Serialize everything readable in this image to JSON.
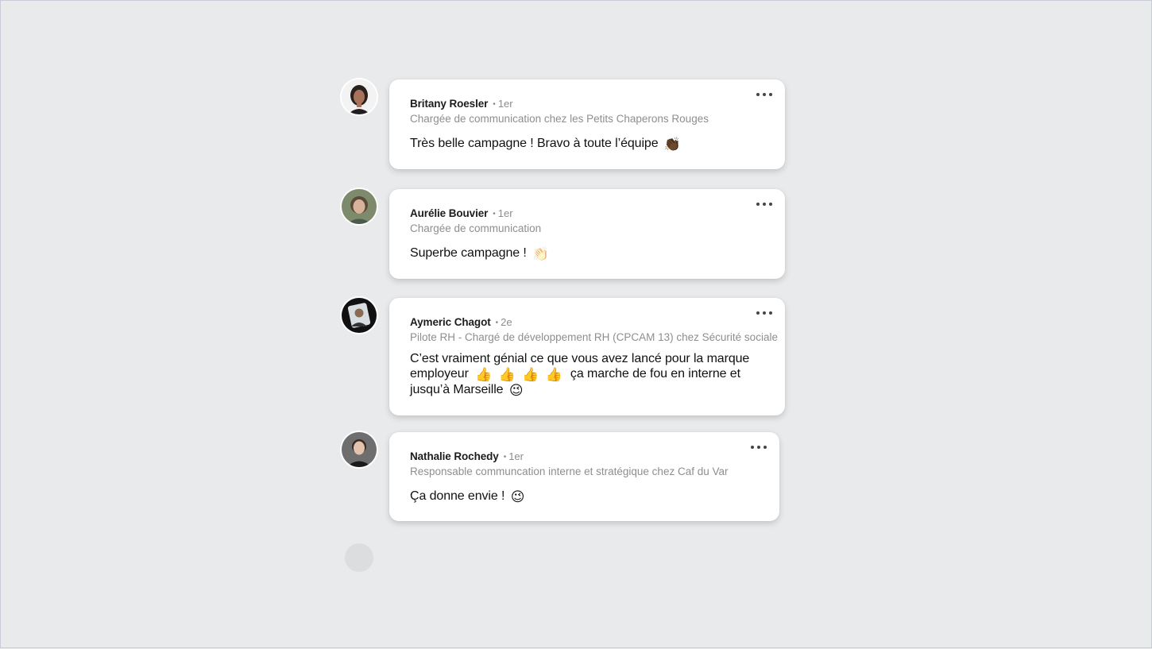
{
  "comments": [
    {
      "author": "Britany Roesler",
      "degree": "1er",
      "headline": "Chargée de communication chez les Petits Chaperons Rouges",
      "text": "Très belle campagne ! Bravo à toute l’équipe",
      "emoji": "👏🏾",
      "avatar_icon": "woman-avatar-icon"
    },
    {
      "author": "Aurélie Bouvier",
      "degree": "1er",
      "headline": "Chargée de communication",
      "text": "Superbe campagne !",
      "emoji": "👏🏻",
      "avatar_icon": "woman-avatar-icon"
    },
    {
      "author": "Aymeric Chagot",
      "degree": "2e",
      "headline": "Pilote RH - Chargé de développement RH (CPCAM 13) chez Sécurité sociale",
      "text_line1": "C’est vraiment génial ce que vous avez lancé pour la marque",
      "text_line2_start": "employeur",
      "thumbs": [
        "👍",
        "👍",
        "👍",
        "👍"
      ],
      "text_line2_end": "ça marche de fou en interne et",
      "text_line3": "jusqu’à Marseille",
      "emoji": "😉",
      "avatar_icon": "man-avatar-icon"
    },
    {
      "author": "Nathalie Rochedy",
      "degree": "1er",
      "headline": "Responsable communcation interne et stratégique chez Caf du Var",
      "text": "Ça donne envie !",
      "emoji": "😉",
      "avatar_icon": "man-avatar-icon"
    }
  ],
  "colors": {
    "background": "#e9eaec",
    "card": "#ffffff",
    "author": "#1c1c1c",
    "muted": "#8e8e8e"
  }
}
